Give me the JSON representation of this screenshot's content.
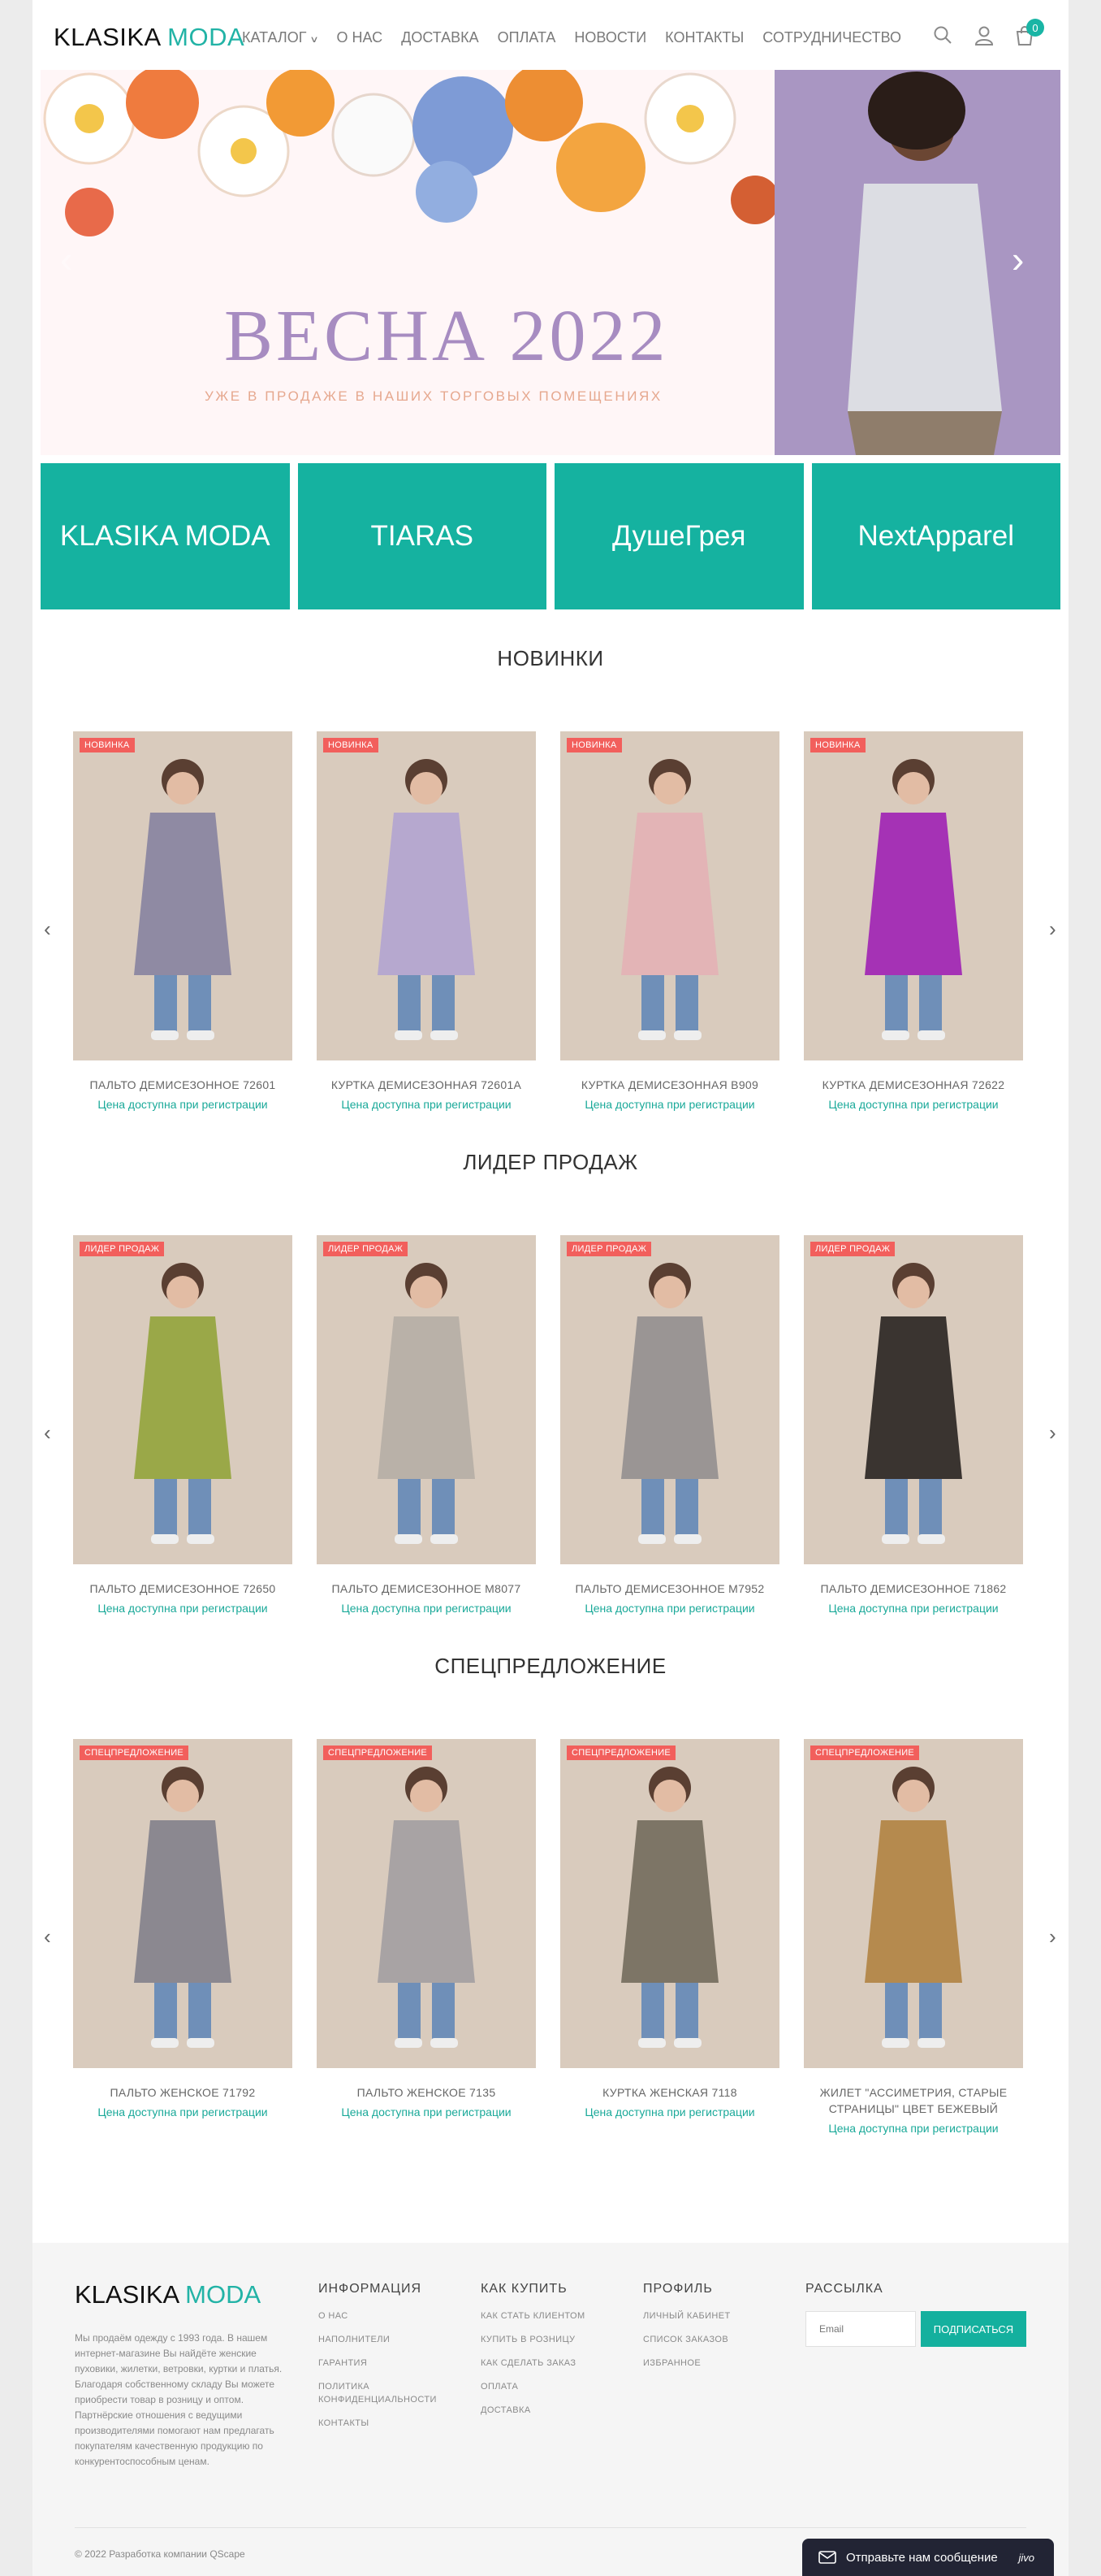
{
  "header": {
    "logo_part1": "KLASIKA",
    "logo_part2": "MODA",
    "nav": [
      "КАТАЛОГ",
      "О НАС",
      "ДОСТАВКА",
      "ОПЛАТА",
      "НОВОСТИ",
      "КОНТАКТЫ",
      "СОТРУДНИЧЕСТВО"
    ],
    "cart_count": "0"
  },
  "banner": {
    "title": "ВЕСНА 2022",
    "subtitle": "УЖЕ В ПРОДАЖЕ В НАШИХ ТОРГОВЫХ ПОМЕЩЕНИЯХ"
  },
  "brands": [
    "KLASIKA MODA",
    "TIARAS",
    "ДушеГрея",
    "NextApparel"
  ],
  "sections": [
    {
      "title": "НОВИНКИ",
      "products": [
        {
          "badge": "НОВИНКА",
          "name": "ПАЛЬТО ДЕМИСЕЗОННОЕ 72601",
          "price": "Цена доступна при регистрации",
          "color": "#8f8aa3"
        },
        {
          "badge": "НОВИНКА",
          "name": "КУРТКА ДЕМИСЕЗОННАЯ 72601А",
          "price": "Цена доступна при регистрации",
          "color": "#b6a8cf"
        },
        {
          "badge": "НОВИНКА",
          "name": "КУРТКА ДЕМИСЕЗОННАЯ В909",
          "price": "Цена доступна при регистрации",
          "color": "#e3b4b6"
        },
        {
          "badge": "НОВИНКА",
          "name": "КУРТКА ДЕМИСЕЗОННАЯ 72622",
          "price": "Цена доступна при регистрации",
          "color": "#a532b5"
        }
      ]
    },
    {
      "title": "ЛИДЕР ПРОДАЖ",
      "products": [
        {
          "badge": "ЛИДЕР ПРОДАЖ",
          "name": "ПАЛЬТО ДЕМИСЕЗОННОЕ 72650",
          "price": "Цена доступна при регистрации",
          "color": "#9aa848"
        },
        {
          "badge": "ЛИДЕР ПРОДАЖ",
          "name": "ПАЛЬТО ДЕМИСЕЗОННОЕ М8077",
          "price": "Цена доступна при регистрации",
          "color": "#b9b1a8"
        },
        {
          "badge": "ЛИДЕР ПРОДАЖ",
          "name": "ПАЛЬТО ДЕМИСЕЗОННОЕ М7952",
          "price": "Цена доступна при регистрации",
          "color": "#9a9594"
        },
        {
          "badge": "ЛИДЕР ПРОДАЖ",
          "name": "ПАЛЬТО ДЕМИСЕЗОННОЕ 71862",
          "price": "Цена доступна при регистрации",
          "color": "#3a3430"
        }
      ]
    },
    {
      "title": "СПЕЦПРЕДЛОЖЕНИЕ",
      "products": [
        {
          "badge": "СПЕЦПРЕДЛОЖЕНИЕ",
          "name": "ПАЛЬТО ЖЕНСКОЕ 71792",
          "price": "Цена доступна при регистрации",
          "color": "#8b8890"
        },
        {
          "badge": "СПЕЦПРЕДЛОЖЕНИЕ",
          "name": "ПАЛЬТО ЖЕНСКОЕ 7135",
          "price": "Цена доступна при регистрации",
          "color": "#a8a3a4"
        },
        {
          "badge": "СПЕЦПРЕДЛОЖЕНИЕ",
          "name": "КУРТКА ЖЕНСКАЯ 7118",
          "price": "Цена доступна при регистрации",
          "color": "#7d7566"
        },
        {
          "badge": "СПЕЦПРЕДЛОЖЕНИЕ",
          "name": "ЖИЛЕТ \"АССИМЕТРИЯ, СТАРЫЕ СТРАНИЦЫ\" ЦВЕТ БЕЖЕВЫЙ",
          "price": "Цена доступна при регистрации",
          "color": "#b58a4e"
        }
      ]
    }
  ],
  "footer": {
    "logo_part1": "KLASIKA",
    "logo_part2": "MODA",
    "about": "Мы продаём одежду с 1993 года. В нашем интернет-магазине Вы найдёте женские пуховики, жилетки, ветровки, куртки и платья. Благодаря собственному складу Вы можете приобрести товар в розницу и оптом. Партнёрские отношения с ведущими производителями помогают нам предлагать покупателям качественную продукцию по конкурентоспособным ценам.",
    "columns": [
      {
        "title": "ИНФОРМАЦИЯ",
        "links": [
          "О НАС",
          "НАПОЛНИТЕЛИ",
          "ГАРАНТИЯ",
          "ПОЛИТИКА КОНФИДЕНЦИАЛЬНОСТИ",
          "КОНТАКТЫ"
        ]
      },
      {
        "title": "КАК КУПИТЬ",
        "links": [
          "КАК СТАТЬ КЛИЕНТОМ",
          "КУПИТЬ В РОЗНИЦУ",
          "КАК СДЕЛАТЬ ЗАКАЗ",
          "ОПЛАТА",
          "ДОСТАВКА"
        ]
      },
      {
        "title": "ПРОФИЛЬ",
        "links": [
          "ЛИЧНЫЙ КАБИНЕТ",
          "СПИСОК ЗАКАЗОВ",
          "ИЗБРАННОЕ"
        ]
      }
    ],
    "newsletter_title": "РАССЫЛКА",
    "email_placeholder": "Email",
    "subscribe_label": "ПОДПИСАТЬСЯ",
    "copyright": "© 2022 Разработка компании QScape",
    "chat_label": "Отправьте нам сообщение",
    "chat_brand": "jivo"
  }
}
